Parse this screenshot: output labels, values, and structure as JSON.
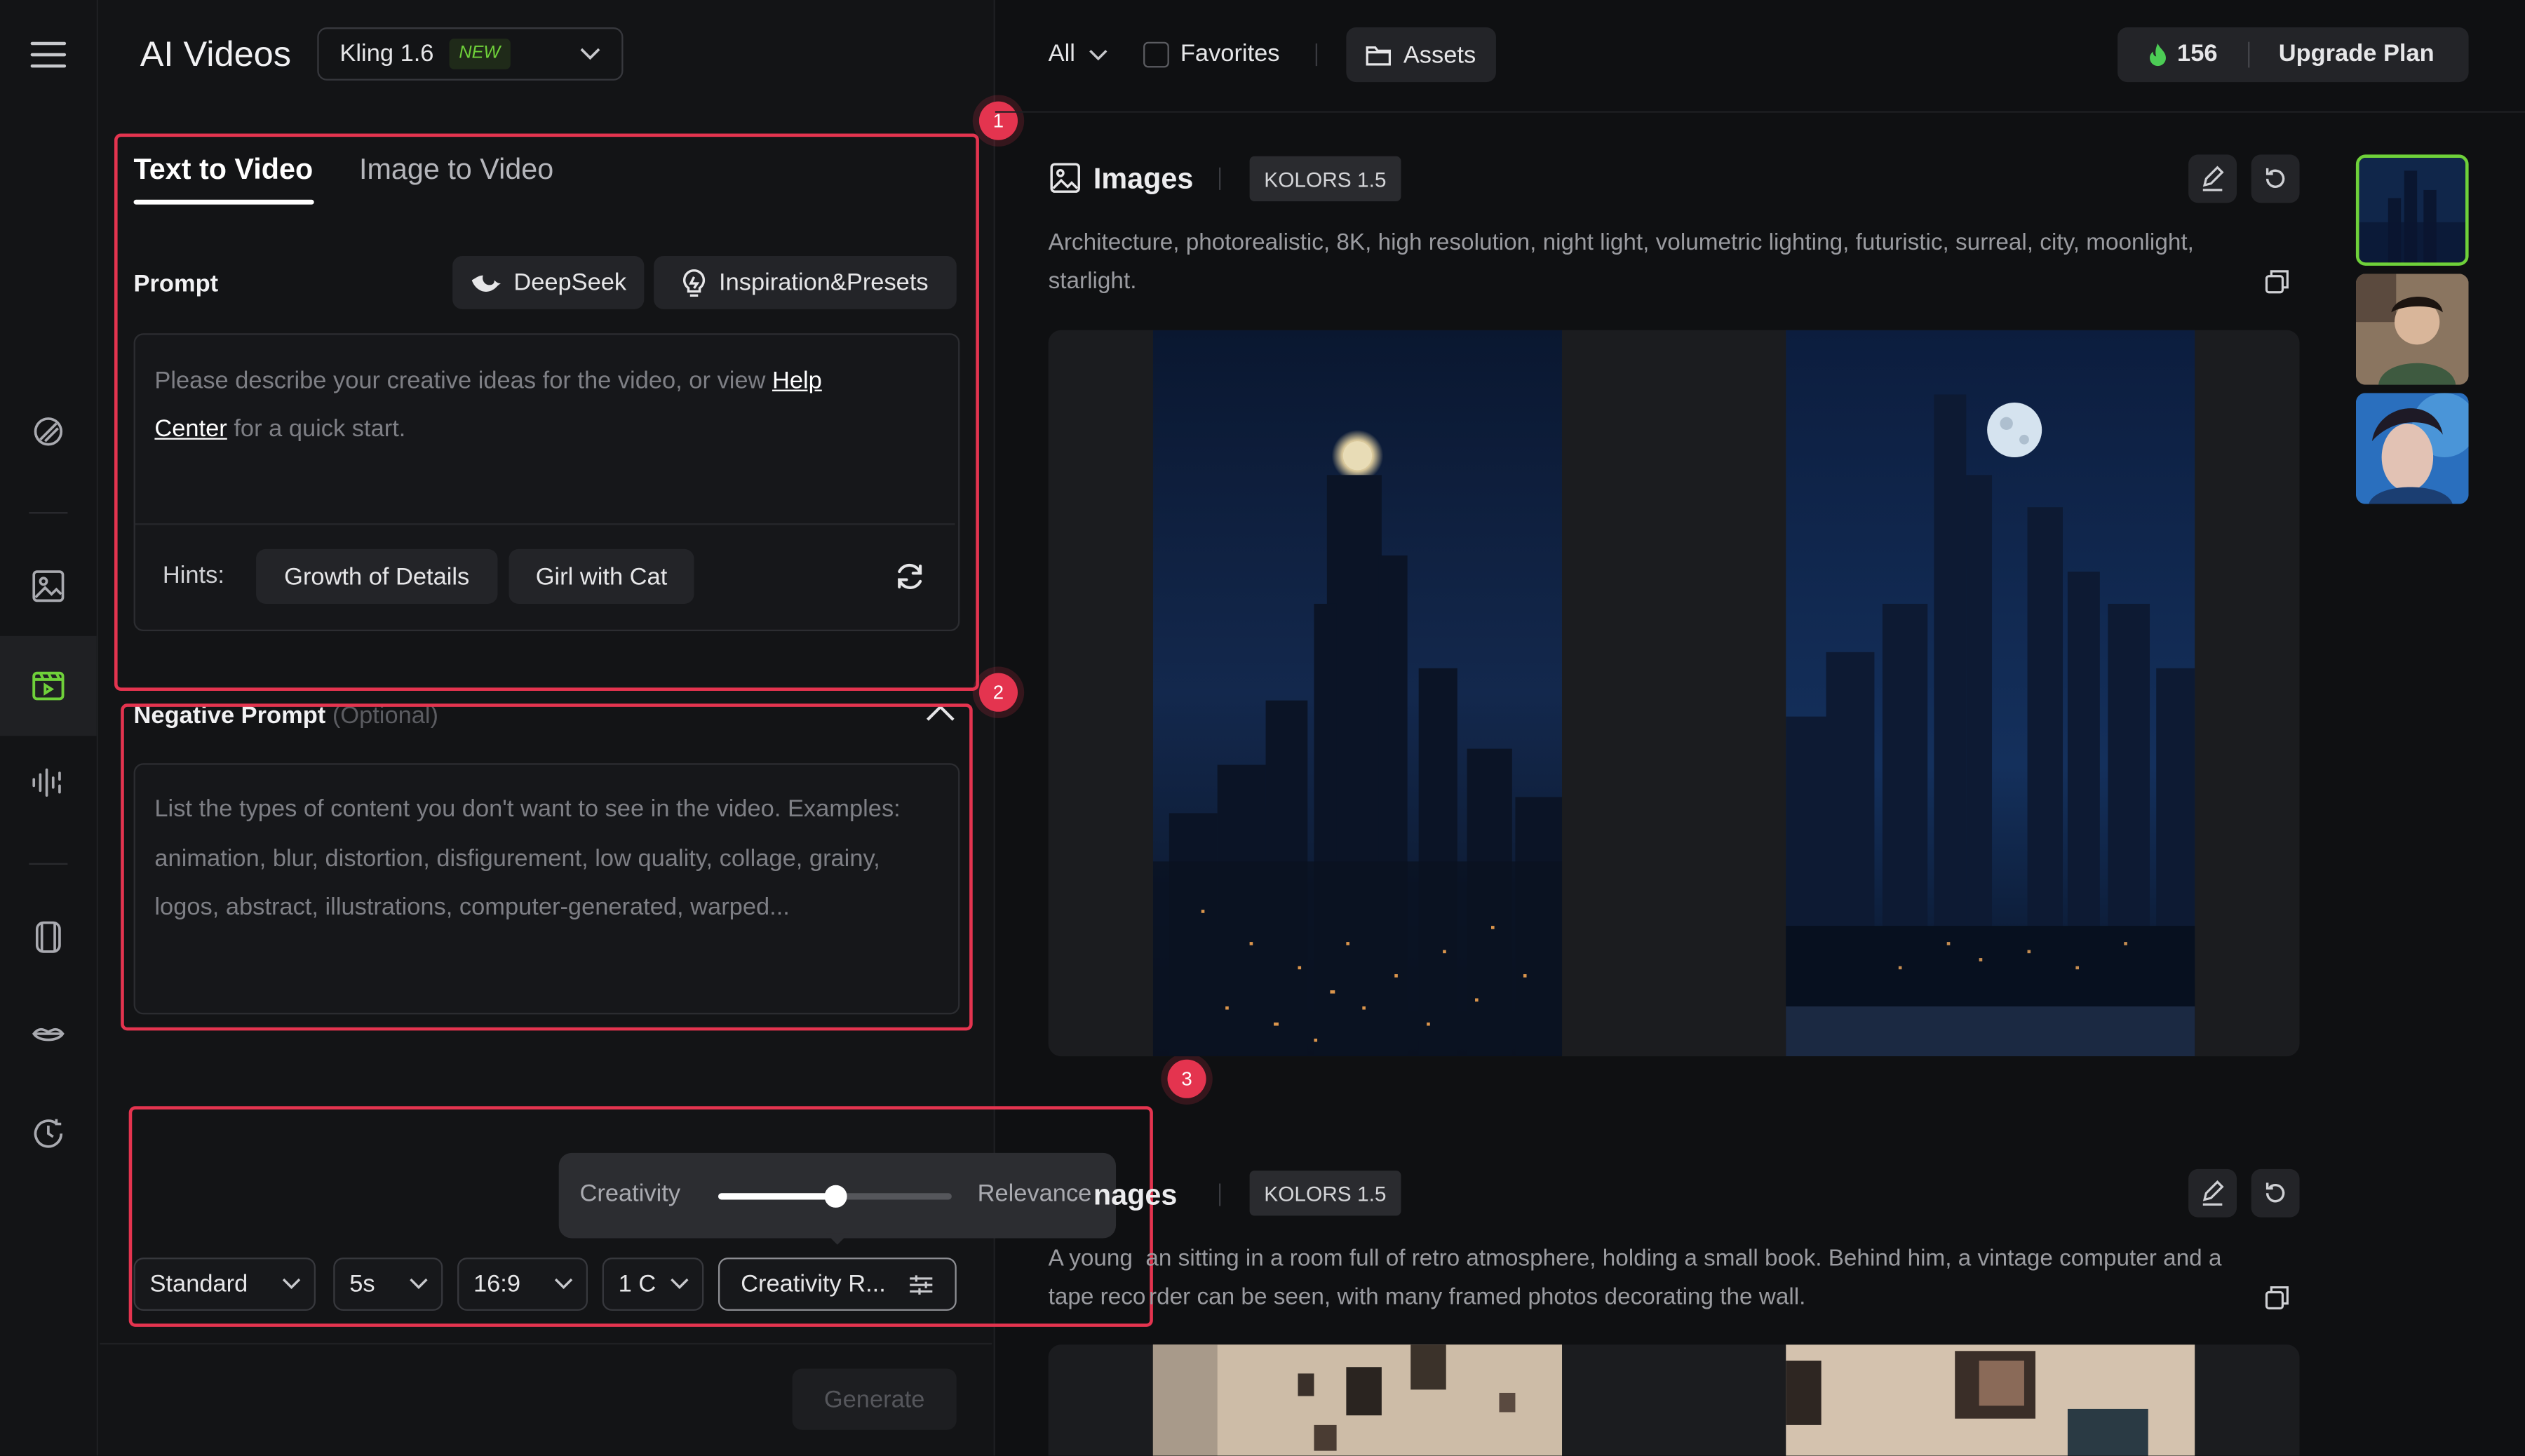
{
  "header": {
    "title": "AI Videos",
    "model_name": "Kling 1.6",
    "model_badge": "NEW"
  },
  "tabs": [
    {
      "label": "Text to Video",
      "active": true
    },
    {
      "label": "Image to Video",
      "active": false
    }
  ],
  "prompt": {
    "label": "Prompt",
    "deepseek_label": "DeepSeek",
    "inspiration_label": "Inspiration&Presets",
    "placeholder_start": "Please describe your creative ideas for the video, or view ",
    "help_link_1": "Help",
    "help_link_2": "Center",
    "placeholder_end": " for a quick start.",
    "hints_label": "Hints:",
    "hints": [
      "Growth of Details",
      "Girl with Cat"
    ]
  },
  "negative_prompt": {
    "label": "Negative Prompt",
    "optional": "(Optional)",
    "placeholder": "List the types of content you don't want to see in the video. Examples: animation, blur, distortion, disfigurement, low quality, collage, grainy, logos, abstract, illustrations, computer-generated, warped..."
  },
  "settings": {
    "slider_left": "Creativity",
    "slider_right": "Relevance",
    "slider_value": 0.5,
    "mode": "Standard",
    "duration": "5s",
    "aspect": "16:9",
    "count": "1 C",
    "creativity_button": "Creativity R...",
    "generate": "Generate"
  },
  "markers": [
    "1",
    "2",
    "3"
  ],
  "topbar": {
    "filter": "All",
    "favorites": "Favorites",
    "assets": "Assets",
    "credits": "156",
    "upgrade": "Upgrade Plan"
  },
  "feed": [
    {
      "title": "Images",
      "model": "KOLORS 1.5",
      "description": "Architecture, photorealistic, 8K, high resolution, night light, volumetric lighting, futuristic, surreal, city, moonlight, starlight."
    },
    {
      "title": "Images",
      "title_visible": "nages",
      "model": "KOLORS 1.5",
      "description": "A young man sitting in a room full of retro atmosphere, holding a small book. Behind him, a vintage computer and a tape recorder can be seen, with many framed photos decorating the wall.",
      "description_visible": [
        "A young ",
        "an sitting in a room full of retro atmosphere, holding a small book. Behind him, a vintage computer and a",
        "tape reco",
        "rder can be seen, with many framed photos decorating the wall."
      ]
    }
  ],
  "colors": {
    "accent_red": "#e4344f",
    "new_green": "#6fd13a",
    "credit_green": "#4ccc55"
  },
  "icons": [
    "menu-icon",
    "magic-brush-icon",
    "image-icon",
    "video-icon",
    "audio-icon",
    "avatar-icon",
    "lips-icon",
    "history-icon",
    "chevron-down-icon",
    "deepseek-whale-icon",
    "lightbulb-icon",
    "refresh-icon",
    "chevron-up-icon",
    "sliders-icon",
    "folder-icon",
    "flame-icon",
    "edit-icon",
    "undo-icon",
    "copy-icon"
  ]
}
